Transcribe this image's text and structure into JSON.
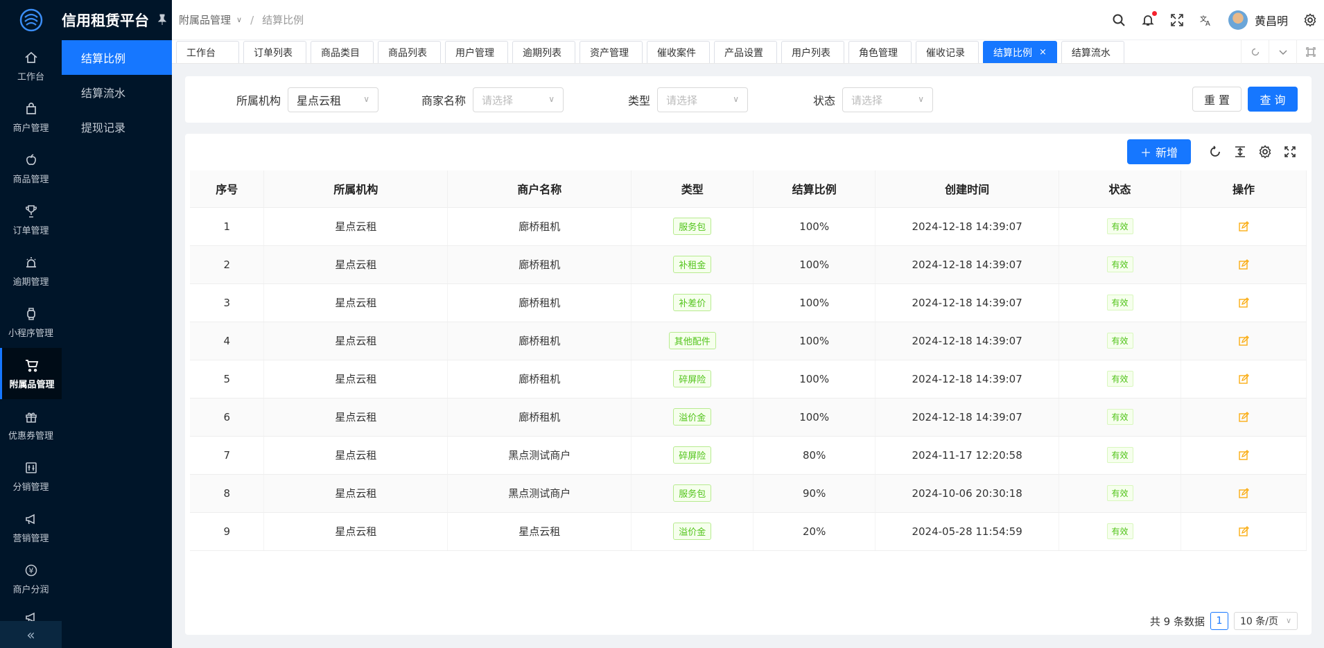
{
  "app": {
    "title": "信用租赁平台"
  },
  "rail": {
    "items": [
      {
        "label": "工作台",
        "icon": "home-icon"
      },
      {
        "label": "商户管理",
        "icon": "bag-icon"
      },
      {
        "label": "商品管理",
        "icon": "apple-icon"
      },
      {
        "label": "订单管理",
        "icon": "trophy-icon"
      },
      {
        "label": "逾期管理",
        "icon": "alarm-icon"
      },
      {
        "label": "小程序管理",
        "icon": "watch-icon"
      },
      {
        "label": "附属品管理",
        "icon": "cart-icon",
        "active": true
      },
      {
        "label": "优惠券管理",
        "icon": "gift-icon"
      },
      {
        "label": "分销管理",
        "icon": "sliders-icon"
      },
      {
        "label": "营销管理",
        "icon": "megaphone-icon"
      },
      {
        "label": "商户分润",
        "icon": "yen-icon"
      }
    ],
    "collapse": "«"
  },
  "submenu": {
    "items": [
      "结算比例",
      "结算流水",
      "提现记录"
    ]
  },
  "breadcrumb": {
    "parent": "附属品管理",
    "current": "结算比例"
  },
  "user": {
    "name": "黄昌明"
  },
  "tabs": [
    "工作台",
    "订单列表",
    "商品类目",
    "商品列表",
    "用户管理",
    "逾期列表",
    "资产管理",
    "催收案件",
    "产品设置",
    "用户列表",
    "角色管理",
    "催收记录",
    "结算比例",
    "结算流水"
  ],
  "active_tab": "结算比例",
  "search": {
    "org_label": "所属机构",
    "org_value": "星点云租",
    "merchant_label": "商家名称",
    "merchant_placeholder": "请选择",
    "type_label": "类型",
    "type_placeholder": "请选择",
    "status_label": "状态",
    "status_placeholder": "请选择",
    "reset": "重 置",
    "query": "查 询"
  },
  "toolbar": {
    "add": "新增"
  },
  "table": {
    "headers": [
      "序号",
      "所属机构",
      "商户名称",
      "类型",
      "结算比例",
      "创建时间",
      "状态",
      "操作"
    ],
    "rows": [
      [
        "1",
        "星点云租",
        "廊桥租机",
        "服务包",
        "100%",
        "2024-12-18 14:39:07",
        "有效"
      ],
      [
        "2",
        "星点云租",
        "廊桥租机",
        "补租金",
        "100%",
        "2024-12-18 14:39:07",
        "有效"
      ],
      [
        "3",
        "星点云租",
        "廊桥租机",
        "补差价",
        "100%",
        "2024-12-18 14:39:07",
        "有效"
      ],
      [
        "4",
        "星点云租",
        "廊桥租机",
        "其他配件",
        "100%",
        "2024-12-18 14:39:07",
        "有效"
      ],
      [
        "5",
        "星点云租",
        "廊桥租机",
        "碎屏险",
        "100%",
        "2024-12-18 14:39:07",
        "有效"
      ],
      [
        "6",
        "星点云租",
        "廊桥租机",
        "溢价金",
        "100%",
        "2024-12-18 14:39:07",
        "有效"
      ],
      [
        "7",
        "星点云租",
        "黑点测试商户",
        "碎屏险",
        "80%",
        "2024-11-17 12:20:58",
        "有效"
      ],
      [
        "8",
        "星点云租",
        "黑点测试商户",
        "服务包",
        "90%",
        "2024-10-06 20:30:18",
        "有效"
      ],
      [
        "9",
        "星点云租",
        "星点云租",
        "溢价金",
        "20%",
        "2024-05-28 11:54:59",
        "有效"
      ]
    ]
  },
  "pager": {
    "total": "共 9 条数据",
    "page": "1",
    "size": "10 条/页"
  },
  "colors": {
    "primary": "#1677ff",
    "sidebar": "#001529",
    "success": "#52c41a",
    "edit": "#faad14"
  }
}
